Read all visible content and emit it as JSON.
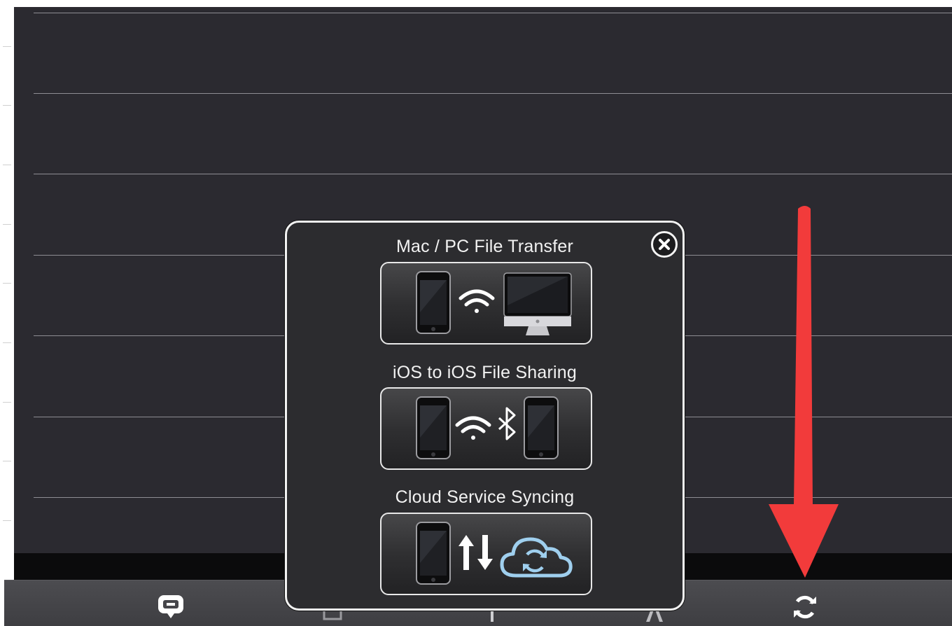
{
  "popup": {
    "sections": [
      {
        "title": "Mac / PC File Transfer",
        "icons": [
          "iphone-icon",
          "wifi-icon",
          "imac-icon"
        ]
      },
      {
        "title": "iOS to iOS File Sharing",
        "icons": [
          "iphone-icon",
          "wifi-icon",
          "bluetooth-icon",
          "iphone-icon"
        ]
      },
      {
        "title": "Cloud Service Syncing",
        "icons": [
          "iphone-icon",
          "up-down-arrows-icon",
          "cloud-sync-icon"
        ]
      }
    ],
    "close_icon": "close-icon"
  },
  "toolbar": {
    "buttons": [
      "comment-icon",
      "print-icon",
      "add-icon",
      "text-size-icon",
      "sync-icon"
    ]
  },
  "annotation": {
    "arrow_color": "#f23b3b",
    "arrow_icon": "red-arrow-down-icon"
  },
  "colors": {
    "screen_bg": "#2b2a30",
    "toolbar_bg": "#46464a",
    "cloud_accent": "#9fcfee"
  }
}
